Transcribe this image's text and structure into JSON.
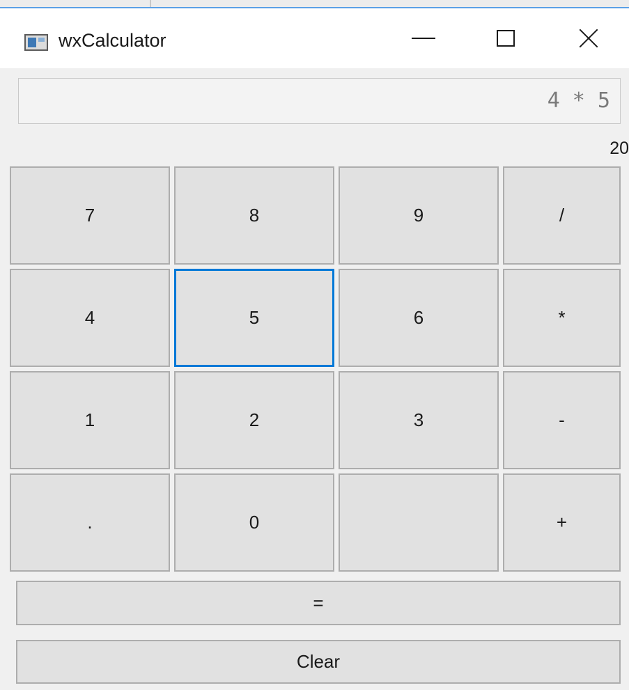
{
  "window": {
    "title": "wxCalculator"
  },
  "display": {
    "expression": "4 * 5",
    "result": "20"
  },
  "keypad": {
    "k7": "7",
    "k8": "8",
    "k9": "9",
    "kdiv": "/",
    "k4": "4",
    "k5": "5",
    "k6": "6",
    "kmul": "*",
    "k1": "1",
    "k2": "2",
    "k3": "3",
    "ksub": "-",
    "kdot": ".",
    "k0": "0",
    "kblank": "",
    "kadd": "+"
  },
  "actions": {
    "equals": "=",
    "clear": "Clear"
  },
  "colors": {
    "focus_accent": "#0078d7",
    "key_face": "#e1e1e1",
    "window_bg": "#f0f0f0"
  },
  "icons": {
    "app": "app-window-icon",
    "minimize": "minimize-icon",
    "maximize": "maximize-icon",
    "close": "close-icon"
  }
}
